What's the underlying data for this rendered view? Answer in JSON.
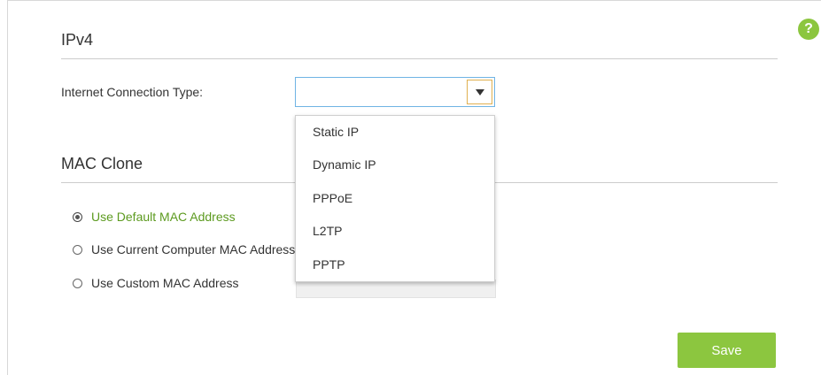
{
  "help": {
    "glyph": "?"
  },
  "ipv4": {
    "title": "IPv4",
    "connection_type_label": "Internet Connection Type:",
    "connection_type_value": "",
    "options": [
      "Static IP",
      "Dynamic IP",
      "PPPoE",
      "L2TP",
      "PPTP"
    ]
  },
  "mac_clone": {
    "title": "MAC Clone",
    "radios": [
      {
        "label": "Use Default MAC Address",
        "checked": true
      },
      {
        "label": "Use Current Computer MAC Address",
        "checked": false
      },
      {
        "label": "Use Custom MAC Address",
        "checked": false
      }
    ]
  },
  "actions": {
    "save_label": "Save"
  },
  "colors": {
    "accent": "#8cc63f",
    "selected_text": "#5c9a1f",
    "focus_border": "#6fb4e4"
  }
}
